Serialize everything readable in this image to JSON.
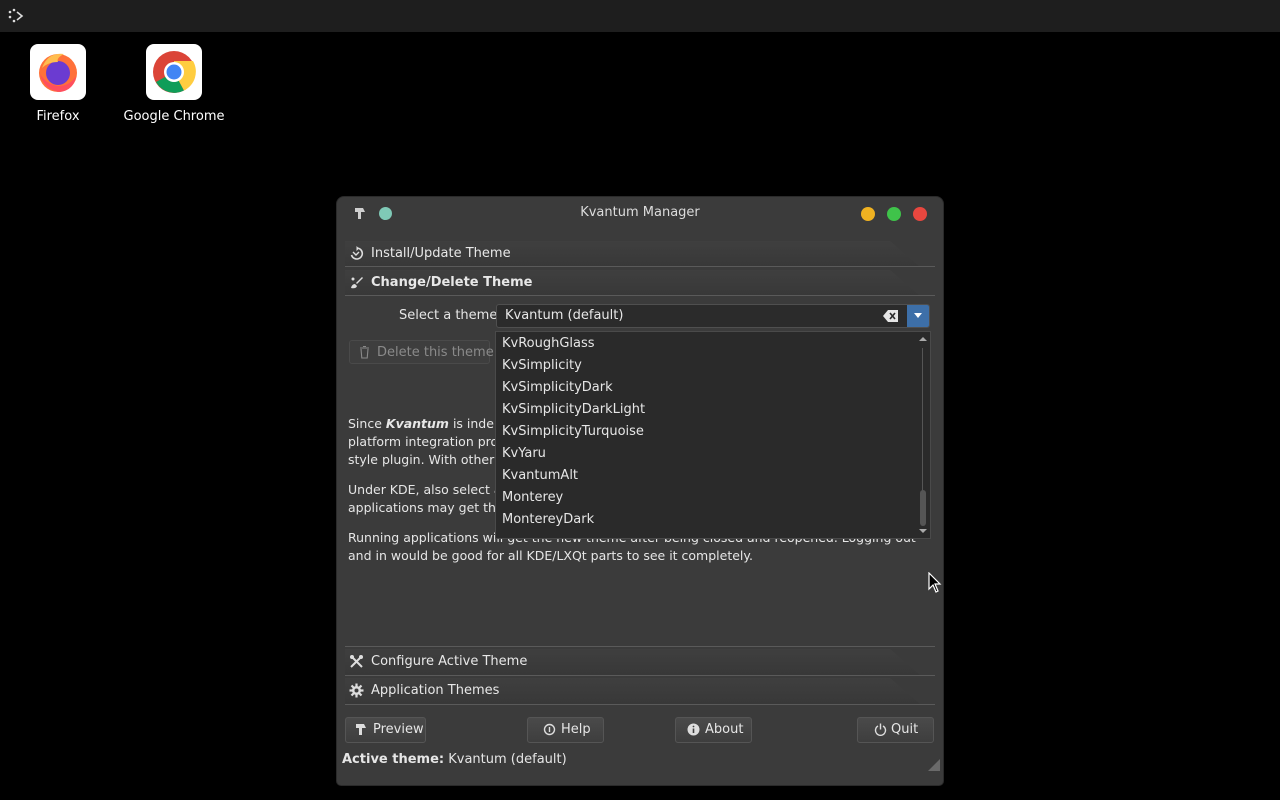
{
  "desktop": {
    "icons": [
      {
        "label": "Firefox"
      },
      {
        "label": "Google Chrome"
      }
    ]
  },
  "window": {
    "title": "Kvantum Manager",
    "sections": {
      "install": "Install/Update Theme",
      "change": "Change/Delete Theme",
      "configure": "Configure Active Theme",
      "apps": "Application Themes"
    },
    "select_label": "Select a theme:",
    "selected_theme": "Kvantum (default)",
    "delete_button": "Delete this theme",
    "info": {
      "p1_lead": "Since",
      "p1_kvantum": "Kvantum",
      "p1_line1": "is indepe",
      "p1_line2": "platform integration prog",
      "p1_line3": "style plugin. With other p",
      "p2_line1": "Under KDE, also select a",
      "p2_line2": "applications may get the",
      "p3": "Running applications will get the new theme after being closed and reopened. Logging out and in would be good for all KDE/LXQt parts to see it completely."
    },
    "dropdown_options": [
      "KvRoughGlass",
      "KvSimplicity",
      "KvSimplicityDark",
      "KvSimplicityDarkLight",
      "KvSimplicityTurquoise",
      "KvYaru",
      "KvantumAlt",
      "Monterey",
      "MontereyDark"
    ],
    "buttons": {
      "preview": "Preview",
      "help": "Help",
      "about": "About",
      "quit": "Quit"
    },
    "status": {
      "label": "Active theme:",
      "value": "Kvantum (default)"
    }
  },
  "colors": {
    "accent": "#3d6fa8",
    "window_bg": "#3b3b3b",
    "close": "#e8473f",
    "minimize": "#f0b221",
    "maximize": "#3fc34a",
    "pin": "#7fc9b6"
  }
}
